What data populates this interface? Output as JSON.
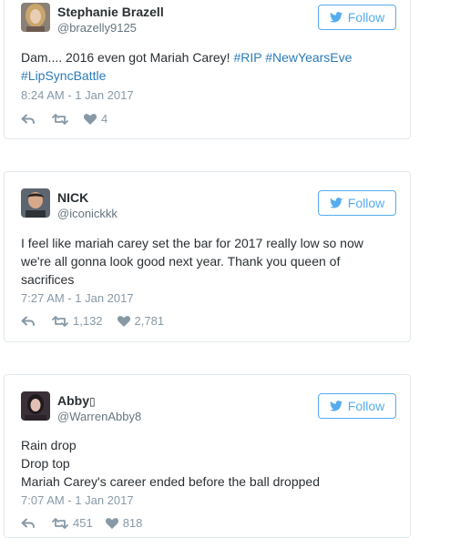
{
  "colors": {
    "link": "#2b7bb9",
    "follow": "#55acee",
    "meta": "#8899a6",
    "border": "#e1e8ed"
  },
  "icons": {
    "follow": "twitter-bird-icon",
    "reply": "reply-icon",
    "retweet": "retweet-icon",
    "like": "heart-icon"
  },
  "tweets": [
    {
      "name": "Stephanie Brazell",
      "handle": "@brazelly9125",
      "follow_label": "Follow",
      "text_plain": "Dam.... 2016 even got Mariah Carey!",
      "hashtags": [
        "#RIP",
        "#NewYearsEve",
        "#LipSyncBattle"
      ],
      "timestamp": "8:24 AM - 1 Jan 2017",
      "retweets": "",
      "likes": "4"
    },
    {
      "name": "NICK",
      "handle": "@iconickkk",
      "follow_label": "Follow",
      "text_lines": [
        "I feel like mariah carey set the bar for 2017 really low so now",
        "we're all gonna look good next year. Thank you queen of",
        "sacrifices"
      ],
      "timestamp": "7:27 AM - 1 Jan 2017",
      "retweets": "1,132",
      "likes": "2,781"
    },
    {
      "name": "Abby",
      "name_suffix": "▯",
      "handle": "@WarrenAbby8",
      "follow_label": "Follow",
      "text_lines": [
        "Rain drop",
        "Drop top",
        "Mariah Carey's career ended before the ball dropped"
      ],
      "timestamp": "7:07 AM - 1 Jan 2017",
      "retweets": "451",
      "likes": "818"
    }
  ]
}
